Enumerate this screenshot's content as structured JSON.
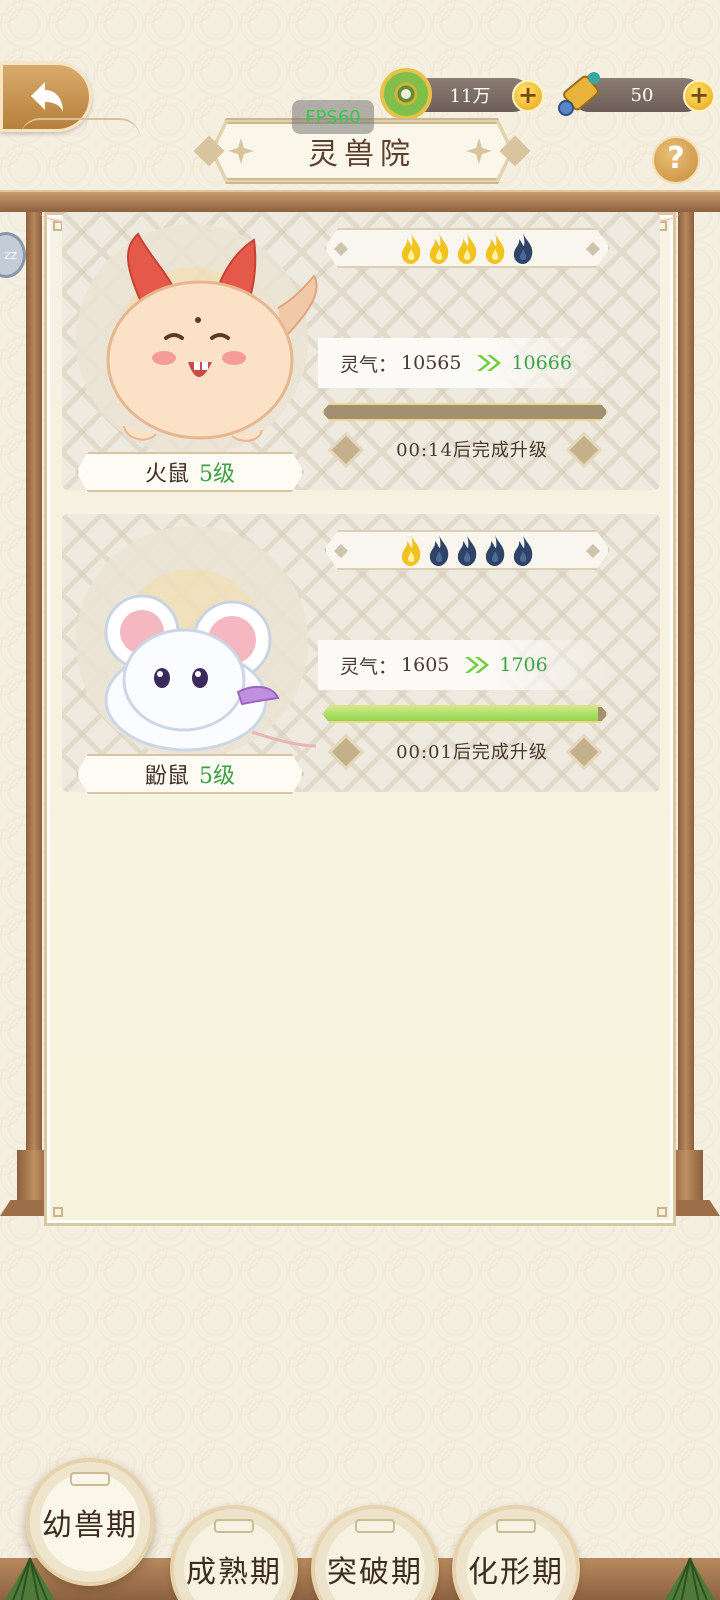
{
  "header": {
    "back_icon": "back-arrow-icon",
    "title": "灵兽院",
    "fps": "FPS60",
    "help_label": "?",
    "currencies": [
      {
        "name": "jade-coin-icon",
        "value": "11万",
        "plus": "+"
      },
      {
        "name": "scroll-ticket-icon",
        "value": "50",
        "plus": "+"
      }
    ]
  },
  "side_bubble": "zz",
  "beasts": [
    {
      "name": "火鼠",
      "level": "5级",
      "stars_filled": 4,
      "stars_total": 5,
      "aura_label": "灵气：",
      "aura_current": "10565",
      "aura_next": "10666",
      "progress": 0.0,
      "timer": "00:14后完成升级",
      "colors": {
        "filled_star": "#f2c21e",
        "empty_star": "#2e4466"
      }
    },
    {
      "name": "鼢鼠",
      "level": "5级",
      "stars_filled": 1,
      "stars_total": 5,
      "aura_label": "灵气：",
      "aura_current": "1605",
      "aura_next": "1706",
      "progress": 0.97,
      "timer": "00:01后完成升级",
      "colors": {
        "filled_star": "#f2c21e",
        "empty_star": "#2e4466"
      }
    }
  ],
  "tabs": [
    {
      "label": "幼兽期",
      "active": true
    },
    {
      "label": "成熟期",
      "active": false
    },
    {
      "label": "突破期",
      "active": false
    },
    {
      "label": "化形期",
      "active": false
    }
  ],
  "colors": {
    "level_green": "#3f9f45",
    "progress_green": "#94d14f",
    "wood": "#a57750"
  }
}
